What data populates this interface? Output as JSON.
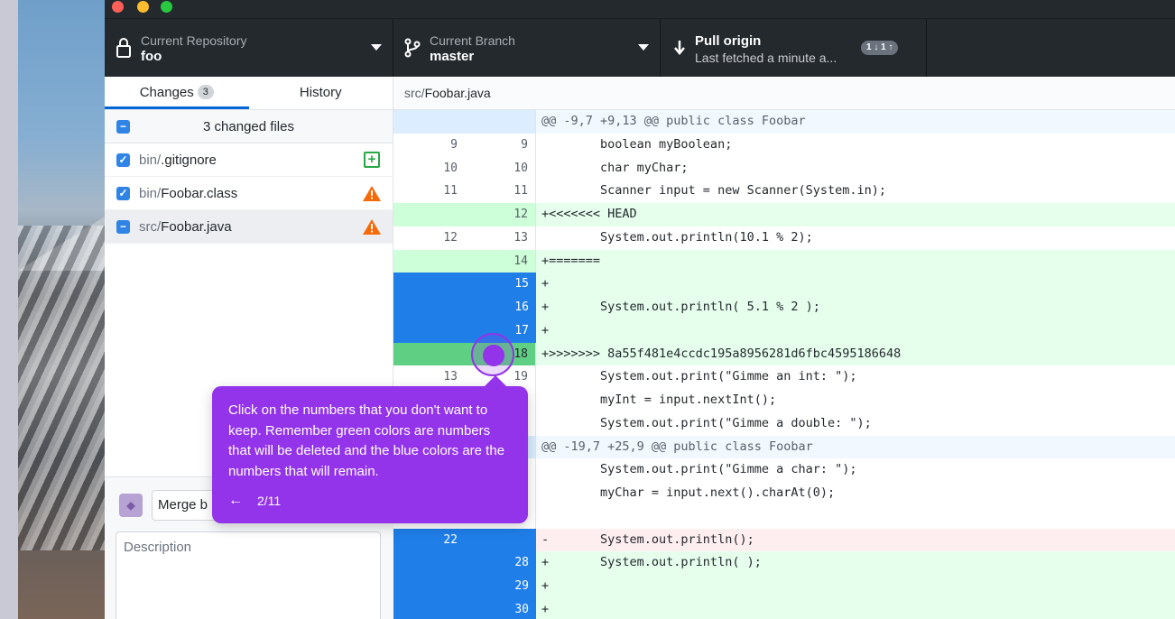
{
  "toolbar": {
    "repo_label": "Current Repository",
    "repo_value": "foo",
    "branch_label": "Current Branch",
    "branch_value": "master",
    "pull_label": "Pull origin",
    "pull_sub": "Last fetched a minute a...",
    "pull_badge": "1 ↓ 1 ↑"
  },
  "sidebar": {
    "tabs": [
      {
        "label": "Changes",
        "count": "3"
      },
      {
        "label": "History"
      }
    ],
    "files_header": "3 changed files",
    "files": [
      {
        "dir": "bin/",
        "name": ".gitignore",
        "status": "added"
      },
      {
        "dir": "bin/",
        "name": "Foobar.class",
        "status": "conflict"
      },
      {
        "dir": "src/",
        "name": "Foobar.java",
        "status": "conflict"
      }
    ],
    "commit": {
      "summary_value": "Merge b",
      "description_placeholder": "Description"
    }
  },
  "diff": {
    "path_dir": "src/",
    "path_name": "Foobar.java",
    "lines": [
      {
        "old": "",
        "new": "",
        "text": "@@ -9,7 +9,13 @@ public class Foobar",
        "type": "hunk"
      },
      {
        "old": "9",
        "new": "9",
        "text": "        boolean myBoolean;",
        "type": "ctx"
      },
      {
        "old": "10",
        "new": "10",
        "text": "        char myChar;",
        "type": "ctx"
      },
      {
        "old": "11",
        "new": "11",
        "text": "        Scanner input = new Scanner(System.in);",
        "type": "ctx"
      },
      {
        "old": "",
        "new": "12",
        "text": "+<<<<<<< HEAD",
        "type": "add"
      },
      {
        "old": "12",
        "new": "13",
        "text": "        System.out.println(10.1 % 2);",
        "type": "ctx"
      },
      {
        "old": "",
        "new": "14",
        "text": "+=======",
        "type": "add"
      },
      {
        "old": "",
        "new": "15",
        "text": "+",
        "type": "add-sel"
      },
      {
        "old": "",
        "new": "16",
        "text": "+       System.out.println( 5.1 % 2 );",
        "type": "add-sel"
      },
      {
        "old": "",
        "new": "17",
        "text": "+",
        "type": "add-sel"
      },
      {
        "old": "",
        "new": "18",
        "text": "+>>>>>>> 8a55f481e4ccdc195a8956281d6fbc4595186648",
        "type": "add-dark"
      },
      {
        "old": "13",
        "new": "19",
        "text": "        System.out.print(\"Gimme an int: \");",
        "type": "ctx"
      },
      {
        "old": "",
        "new": "",
        "text": "        myInt = input.nextInt();",
        "type": "ctx"
      },
      {
        "old": "",
        "new": "",
        "text": "        System.out.print(\"Gimme a double: \");",
        "type": "ctx"
      },
      {
        "old": "",
        "new": "",
        "text": "@@ -19,7 +25,9 @@ public class Foobar",
        "type": "hunk"
      },
      {
        "old": "",
        "new": "",
        "text": "        System.out.print(\"Gimme a char: \");",
        "type": "ctx"
      },
      {
        "old": "",
        "new": "",
        "text": "        myChar = input.next().charAt(0);",
        "type": "ctx"
      },
      {
        "old": "",
        "new": "",
        "text": "",
        "type": "ctx"
      },
      {
        "old": "22",
        "new": "",
        "text": "-       System.out.println();",
        "type": "del-sel"
      },
      {
        "old": "",
        "new": "28",
        "text": "+       System.out.println( );",
        "type": "add-sel"
      },
      {
        "old": "",
        "new": "29",
        "text": "+",
        "type": "add-sel"
      },
      {
        "old": "",
        "new": "30",
        "text": "+",
        "type": "add-sel"
      }
    ]
  },
  "tour": {
    "text": "Click on the numbers that you don't want to keep. Remember green colors are numbers that will be deleted and the blue colors are the numbers that will remain.",
    "back": "←",
    "step": "2/11"
  },
  "colors": {
    "accent": "#9333ea",
    "selected_line": "#1f7ee8",
    "addition": "#e6ffed",
    "deletion": "#ffeef0"
  }
}
